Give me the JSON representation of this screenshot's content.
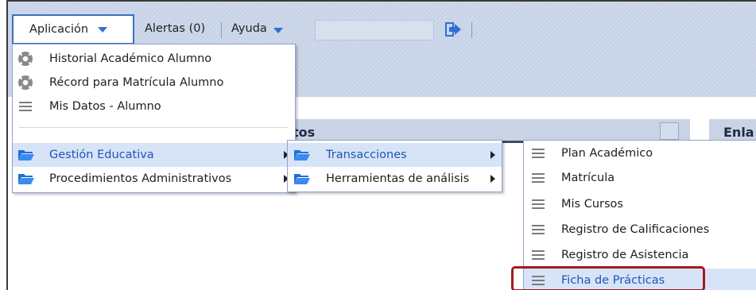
{
  "topbar": {
    "app_menu_label": "Aplicación",
    "alerts_label": "Alertas (0)",
    "help_label": "Ayuda"
  },
  "panels": {
    "left_title_fragment": "tos",
    "right_title_fragment": "Enla"
  },
  "app_menu": {
    "items": [
      {
        "label": "Historial Académico Alumno",
        "icon": "gear-icon"
      },
      {
        "label": "Récord para Matrícula Alumno",
        "icon": "gear-icon"
      },
      {
        "label": "Mis Datos - Alumno",
        "icon": "list-icon"
      },
      {
        "label": "Gestión Educativa",
        "icon": "folder-icon",
        "active": true
      },
      {
        "label": "Procedimientos Administrativos",
        "icon": "folder-icon"
      }
    ]
  },
  "gestion_menu": {
    "items": [
      {
        "label": "Transacciones",
        "icon": "folder-icon",
        "active": true
      },
      {
        "label": "Herramientas de análisis",
        "icon": "folder-icon"
      }
    ]
  },
  "transacciones_menu": {
    "items": [
      {
        "label": "Plan Académico",
        "icon": "list-icon"
      },
      {
        "label": "Matrícula",
        "icon": "list-icon"
      },
      {
        "label": "Mis Cursos",
        "icon": "list-icon"
      },
      {
        "label": "Registro de Calificaciones",
        "icon": "list-icon"
      },
      {
        "label": "Registro de Asistencia",
        "icon": "list-icon"
      },
      {
        "label": "Ficha de Prácticas",
        "icon": "list-icon",
        "active": true
      }
    ]
  },
  "colors": {
    "accent": "#2f6fd6",
    "highlight_border": "#a31a1f",
    "active_row_bg": "#d7e4f7",
    "banner_bg": "#c6d2e6"
  }
}
